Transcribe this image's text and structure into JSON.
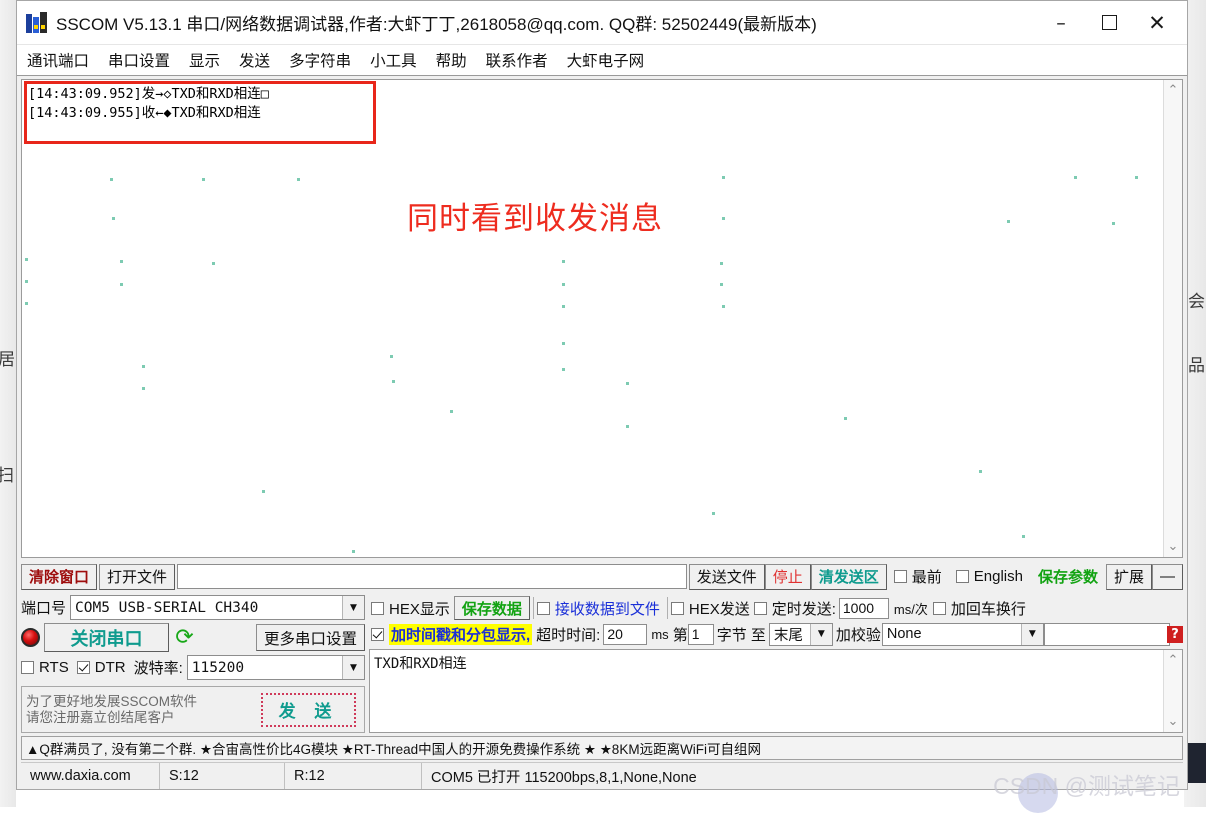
{
  "window": {
    "title": "SSCOM V5.13.1 串口/网络数据调试器,作者:大虾丁丁,2618058@qq.com. QQ群: 52502449(最新版本)",
    "minimize": "–",
    "maximize": "",
    "close": "✕"
  },
  "menu": {
    "items": [
      "通讯端口",
      "串口设置",
      "显示",
      "发送",
      "多字符串",
      "小工具",
      "帮助",
      "联系作者",
      "大虾电子网"
    ]
  },
  "receive": {
    "log_lines": "[14:43:09.952]发→◇TXD和RXD相连□\n[14:43:09.955]收←◆TXD和RXD相连",
    "annotation": "同时看到收发消息",
    "scroll_up": "⌃",
    "scroll_down": "⌄"
  },
  "toolbar": {
    "clear_window": "清除窗口",
    "open_file": "打开文件",
    "file_path": "",
    "send_file": "发送文件",
    "stop": "停止",
    "clear_send": "清发送区",
    "topmost_label": "最前",
    "topmost_checked": false,
    "english_label": "English",
    "english_checked": false,
    "save_params": "保存参数",
    "extend": "扩展",
    "minus": "—"
  },
  "port": {
    "port_label": "端口号",
    "port_value": "COM5 USB-SERIAL CH340",
    "close_port": "关闭串口",
    "more_settings": "更多串口设置",
    "rts_label": "RTS",
    "rts_checked": false,
    "dtr_label": "DTR",
    "dtr_checked": true,
    "baud_label": "波特率:",
    "baud_value": "115200"
  },
  "promo": {
    "text": "为了更好地发展SSCOM软件\n请您注册嘉立创结尾客户",
    "send_button": "发 送"
  },
  "options": {
    "hex_display_label": "HEX显示",
    "hex_display_checked": false,
    "save_data": "保存数据",
    "recv_to_file_label": "接收数据到文件",
    "recv_to_file_checked": false,
    "hex_send_label": "HEX发送",
    "hex_send_checked": false,
    "timed_send_label": "定时发送:",
    "timed_send_checked": false,
    "timed_send_value": "1000",
    "ms_per_time": "ms/次",
    "crlf_label": "加回车换行",
    "crlf_checked": false,
    "timestamp_label": "加时间戳和分包显示,",
    "timestamp_checked": true,
    "timeout_label": "超时时间:",
    "timeout_value": "20",
    "ms": "ms",
    "byte_prefix": "第",
    "byte_start": "1",
    "byte_label": "字节 至",
    "byte_end": "末尾",
    "checksum_label": "加校验",
    "checksum_value": "None",
    "extra_value": "",
    "help": "?"
  },
  "send_area": {
    "text": "TXD和RXD相连"
  },
  "adbar": {
    "text": "▲Q群满员了, 没有第二个群. ★合宙高性价比4G模块 ★RT-Thread中国人的开源免费操作系统 ★ ★8KM远距离WiFi可自组网"
  },
  "status": {
    "site": "www.daxia.com",
    "sent": "S:12",
    "received": "R:12",
    "connection": "COM5 已打开  115200bps,8,1,None,None",
    "watermark": "CSDN @测试笔记"
  },
  "background_glyphs": {
    "left": [
      "居",
      "扫"
    ],
    "right": [
      "会",
      "品"
    ]
  },
  "colors": {
    "accent_red": "#e8261a",
    "annotation_red": "#ee2c1f",
    "teal": "#0f9b8e",
    "green": "#12a312",
    "blue": "#1a2fd8",
    "dark_red": "#9e0d0d",
    "highlight_yellow": "#ffff00"
  }
}
